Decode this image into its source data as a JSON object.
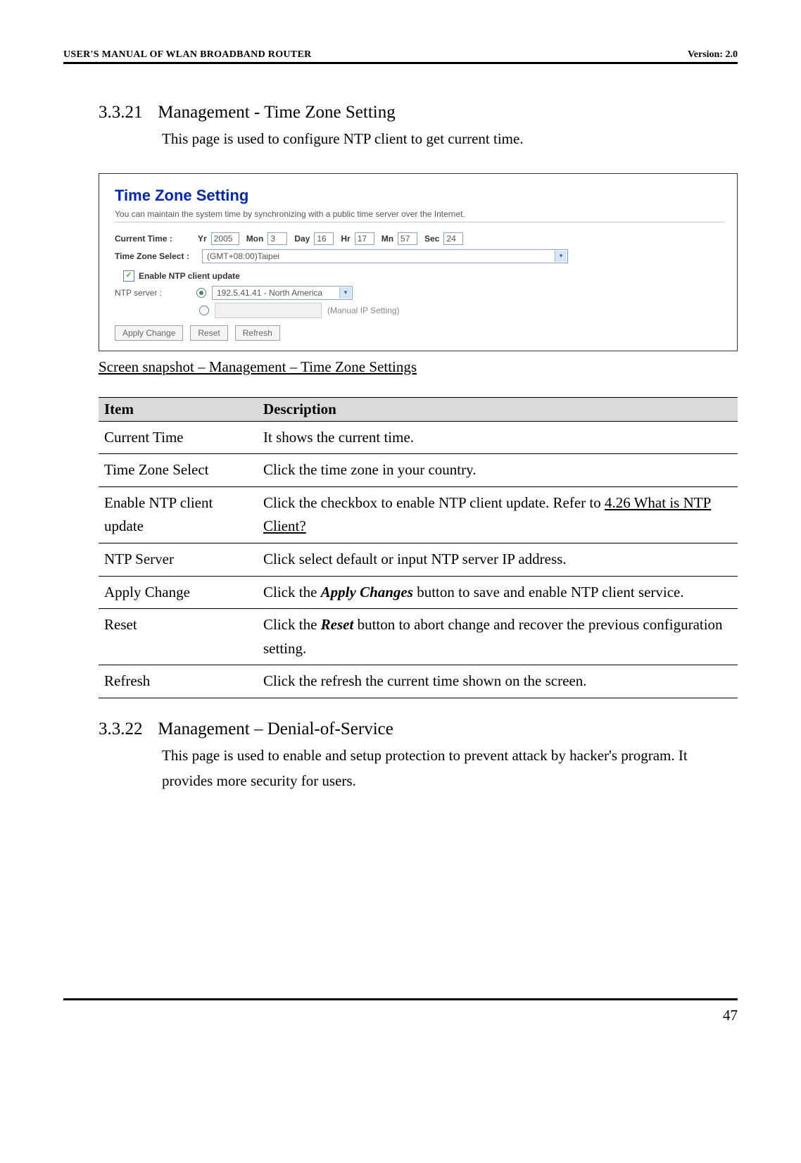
{
  "header": {
    "left": "USER'S MANUAL OF WLAN BROADBAND ROUTER",
    "right": "Version: 2.0"
  },
  "section1": {
    "num": "3.3.21",
    "title": "Management - Time Zone Setting",
    "intro": "This page is used to configure NTP client to get current time."
  },
  "screenshot": {
    "title": "Time Zone Setting",
    "subtitle": "You can maintain the system time by synchronizing with a public time server over the Internet.",
    "current_time_label": "Current Time :",
    "yr_label": "Yr",
    "yr_value": "2005",
    "mon_label": "Mon",
    "mon_value": "3",
    "day_label": "Day",
    "day_value": "16",
    "hr_label": "Hr",
    "hr_value": "17",
    "mn_label": "Mn",
    "mn_value": "57",
    "sec_label": "Sec",
    "sec_value": "24",
    "tz_label": "Time Zone Select :",
    "tz_value": "(GMT+08:00)Taipei",
    "enable_ntp": "Enable NTP client update",
    "ntp_server_label": "NTP server :",
    "ntp_server_value": "192.5.41.41 - North America",
    "manual_ip": "(Manual IP Setting)",
    "btn_apply": "Apply Change",
    "btn_reset": "Reset",
    "btn_refresh": "Refresh"
  },
  "caption": "Screen snapshot – Management – Time Zone Settings",
  "table": {
    "h1": "Item",
    "h2": "Description",
    "rows": [
      {
        "item": "Current Time",
        "desc_plain": "It shows the current time."
      },
      {
        "item": "Time Zone Select",
        "desc_plain": "Click the time zone in your country."
      },
      {
        "item": "Enable NTP client update",
        "desc_prefix": "Click the checkbox to enable NTP client update. Refer to ",
        "desc_link": "4.26 What is NTP Client?"
      },
      {
        "item": "NTP Server",
        "desc_plain": "Click select default or input NTP server IP address."
      },
      {
        "item": "Apply Change",
        "desc_p1": "Click the ",
        "desc_bi": "Apply Changes",
        "desc_p2": " button to save and enable NTP client service."
      },
      {
        "item": "Reset",
        "desc_p1": "Click the ",
        "desc_bi": "Reset",
        "desc_p2": " button to abort change and recover the previous configuration setting."
      },
      {
        "item": "Refresh",
        "desc_plain": "Click the refresh the current time shown on the screen."
      }
    ]
  },
  "section2": {
    "num": "3.3.22",
    "title": "Management – Denial-of-Service",
    "intro": "This page is used to enable and setup protection to prevent attack by hacker's program. It provides more security for users."
  },
  "page_number": "47"
}
